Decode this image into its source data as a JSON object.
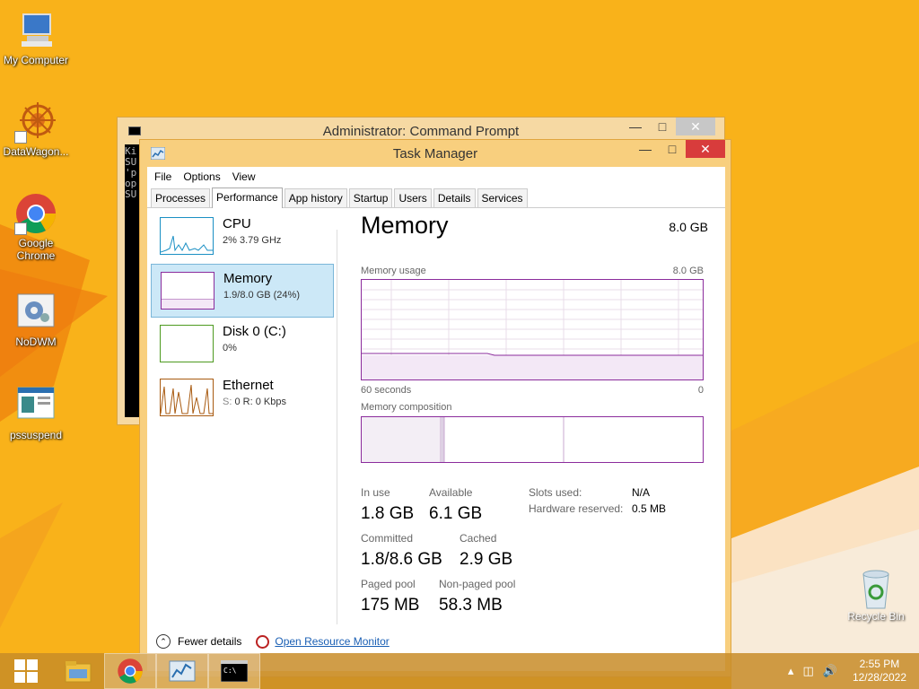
{
  "desktop": {
    "icons": [
      {
        "label": "My Computer",
        "icon": "computer-icon"
      },
      {
        "label": "DataWagon...",
        "icon": "datawagon-icon"
      },
      {
        "label": "Google Chrome",
        "icon": "chrome-icon"
      },
      {
        "label": "NoDWM",
        "icon": "nodwm-icon"
      },
      {
        "label": "pssuspend",
        "icon": "pssuspend-icon"
      }
    ],
    "recycle_bin": "Recycle Bin"
  },
  "cmd_window": {
    "title": "Administrator:  Command Prompt",
    "console_lines": [
      "Ki",
      "SU",
      "'p",
      "op",
      "SU"
    ]
  },
  "task_manager": {
    "title": "Task Manager",
    "menu": [
      "File",
      "Options",
      "View"
    ],
    "tabs": [
      "Processes",
      "Performance",
      "App history",
      "Startup",
      "Users",
      "Details",
      "Services"
    ],
    "active_tab": "Performance",
    "perf_items": [
      {
        "name": "CPU",
        "sub": "2%  3.79 GHz"
      },
      {
        "name": "Memory",
        "sub": "1.9/8.0 GB (24%)"
      },
      {
        "name": "Disk 0 (C:)",
        "sub": "0%"
      },
      {
        "name": "Ethernet",
        "sub_prefix": "S:",
        "sub": " 0  R:  0 Kbps"
      }
    ],
    "detail": {
      "title": "Memory",
      "total": "8.0 GB",
      "usage_label": "Memory usage",
      "usage_max": "8.0 GB",
      "time_left": "60 seconds",
      "time_right": "0",
      "composition_label": "Memory composition",
      "usage_level": 0.24,
      "in_use_label": "In use",
      "in_use": "1.8 GB",
      "available_label": "Available",
      "available": "6.1 GB",
      "slots_label": "Slots used:",
      "slots": "N/A",
      "hw_reserved_label": "Hardware reserved:",
      "hw_reserved": "0.5 MB",
      "committed_label": "Committed",
      "committed": "1.8/8.6 GB",
      "cached_label": "Cached",
      "cached": "2.9 GB",
      "paged_label": "Paged pool",
      "paged": "175 MB",
      "nonpaged_label": "Non-paged pool",
      "nonpaged": "58.3 MB"
    },
    "footer": {
      "fewer_details": "Fewer details",
      "resource_monitor": "Open Resource Monitor"
    }
  },
  "taskbar": {
    "time": "2:55 PM",
    "date": "12/28/2022"
  },
  "colors": {
    "wallpaper": "#f9b21a",
    "memory_accent": "#8b2c9c",
    "cpu_accent": "#1a8fc4",
    "disk_accent": "#4d9a1f",
    "ethernet_accent": "#a85a10",
    "selected_bg": "#cce8f7"
  }
}
